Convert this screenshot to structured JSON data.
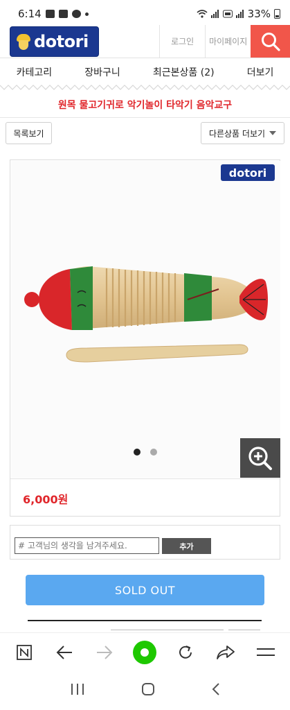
{
  "status_bar": {
    "time": "6:14",
    "battery_percent": "33%",
    "icons": [
      "gallery-icon",
      "youtube-icon",
      "globe-icon",
      "notification-dot-icon",
      "wifi-icon",
      "signal-icon",
      "volte-icon",
      "signal-bars-icon",
      "battery-icon"
    ]
  },
  "header": {
    "logo_text": "dotori",
    "login_label": "로그인",
    "mypage_label": "마이페이지",
    "search_icon": "search-icon",
    "brand_color": "#1b3890",
    "accent_color": "#f1564a"
  },
  "nav": {
    "items": [
      {
        "label": "카테고리"
      },
      {
        "label": "장바구니"
      },
      {
        "label": "최근본상품 (2)"
      },
      {
        "label": "더보기"
      }
    ]
  },
  "notice": {
    "text": "원목 물고기귀로 악기놀이 타악기 음악교구",
    "color": "#e0262b"
  },
  "actions": {
    "list_view_label": "목록보기",
    "other_products_label": "다른상품 더보기"
  },
  "product": {
    "watermark_logo": "dotori",
    "image_count": 2,
    "active_image": 1,
    "price": "6,000원",
    "zoom_icon": "zoom-in-icon"
  },
  "comment": {
    "placeholder": "# 고객님의 생각을 남겨주세요.",
    "add_label": "추가"
  },
  "purchase": {
    "soldout_label": "SOLD OUT",
    "button_color": "#5aa8f0"
  },
  "browser_toolbar": {
    "icons": [
      "naver-icon",
      "back-arrow-icon",
      "forward-arrow-icon",
      "home-circle-icon",
      "refresh-icon",
      "share-icon",
      "menu-icon"
    ]
  },
  "system_nav": {
    "icons": [
      "recent-apps-icon",
      "home-icon",
      "back-icon"
    ]
  }
}
